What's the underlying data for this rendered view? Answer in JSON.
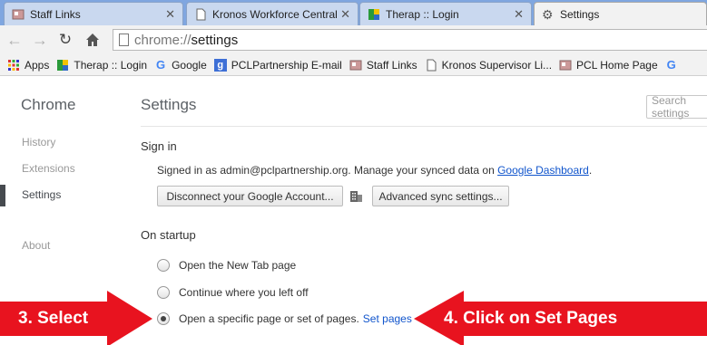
{
  "tabs": [
    {
      "title": "Staff Links",
      "icon": "staff-links-favicon"
    },
    {
      "title": "Kronos Workforce Central",
      "icon": "document-favicon"
    },
    {
      "title": "Therap :: Login",
      "icon": "therap-favicon"
    },
    {
      "title": "Settings",
      "icon": "gear-favicon"
    }
  ],
  "toolbar": {
    "url_scheme": "chrome://",
    "url_path": "settings",
    "back_icon": "back-arrow-icon",
    "forward_icon": "forward-arrow-icon",
    "reload_icon": "reload-icon",
    "home_icon": "home-icon"
  },
  "bookmarks": [
    {
      "label": "Apps",
      "icon": "apps-icon"
    },
    {
      "label": "Therap :: Login",
      "icon": "therap-favicon"
    },
    {
      "label": "Google",
      "icon": "google-icon"
    },
    {
      "label": "PCLPartnership E-mail",
      "icon": "mail-favicon"
    },
    {
      "label": "Staff Links",
      "icon": "staff-links-favicon"
    },
    {
      "label": "Kronos Supervisor Li...",
      "icon": "document-favicon"
    },
    {
      "label": "PCL Home Page",
      "icon": "staff-links-favicon"
    },
    {
      "label": "G",
      "icon": "google-icon"
    }
  ],
  "sidebar": {
    "title": "Chrome",
    "items": [
      "History",
      "Extensions",
      "Settings",
      "About"
    ],
    "selected": "Settings"
  },
  "main": {
    "title": "Settings",
    "search_placeholder": "Search settings",
    "sign_in": {
      "heading": "Sign in",
      "text": "Signed in as admin@pclpartnership.org. Manage your synced data on ",
      "link": "Google Dashboard",
      "text_end": ".",
      "disconnect_button": "Disconnect your Google Account...",
      "sync_button": "Advanced sync settings..."
    },
    "startup": {
      "heading": "On startup",
      "options": [
        {
          "label": "Open the New Tab page",
          "checked": false
        },
        {
          "label": "Continue where you left off",
          "checked": false
        },
        {
          "label": "Open a specific page or set of pages.",
          "checked": true,
          "link": "Set pages"
        }
      ]
    }
  },
  "annotations": {
    "left": "3. Select",
    "right": "4. Click on Set Pages",
    "color": "#e8131f"
  },
  "colors": {
    "tabstrip": "#7fa6e0",
    "link": "#1155cc"
  }
}
